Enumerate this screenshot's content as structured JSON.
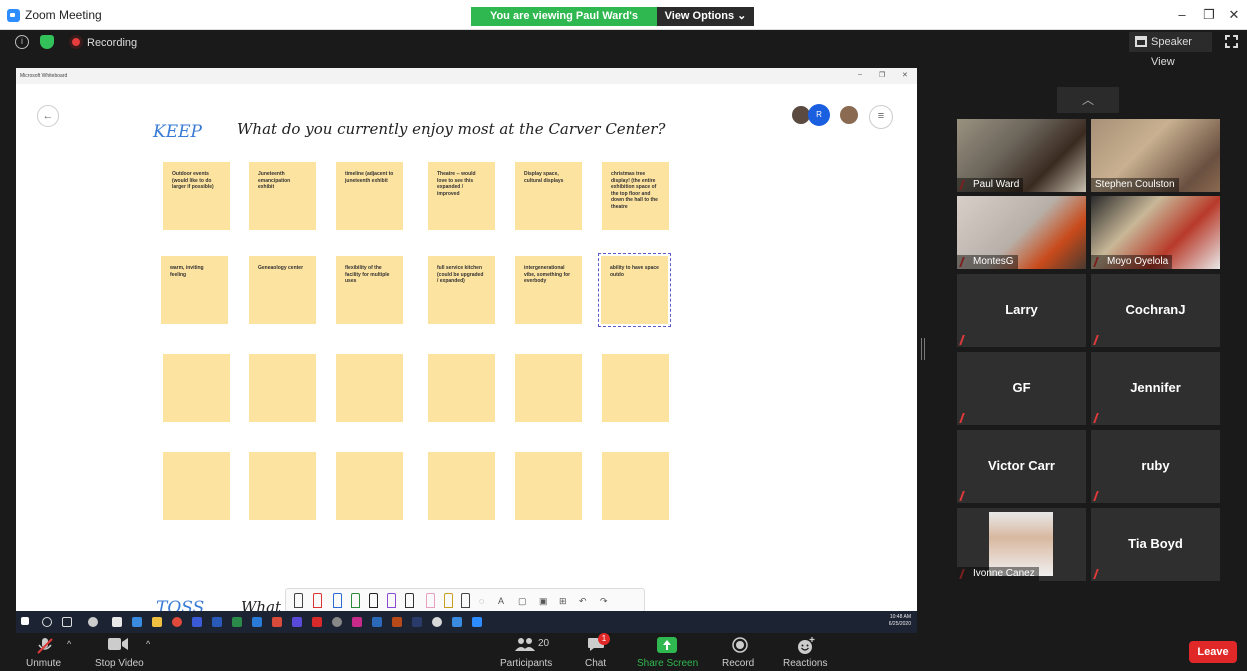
{
  "window": {
    "title": "Zoom Meeting"
  },
  "banner": {
    "text": "You are viewing Paul Ward's screen",
    "view_options": "View Options ⌄"
  },
  "status": {
    "recording": "Recording"
  },
  "top_right": {
    "speaker_view": "Speaker View"
  },
  "whiteboard": {
    "window_title": "Microsoft Whiteboard",
    "keep": "KEEP",
    "question": "What do you currently enjoy most at the Carver Center?",
    "toss": "TOSS",
    "toss_question": "What",
    "avatar_initial": "R",
    "notes_row1": [
      "Outdoor events (would like to do larger if possible)",
      "Juneteenth emancipation exhibit",
      "timeline (adjacent to juneteenth exhibit",
      "Theatre -- would love to see this expanded / improved",
      "Display space, cultural displays",
      "christmas tree display! (the entire exhibition space of the top floor and down the hall to the theatre"
    ],
    "notes_row2": [
      "warm, inviting feeling",
      "Geneaology center",
      "flexibility of the facility for multiple uses",
      "full service kitchen (could be upgraded / expanded)",
      "intergenerational vibe, something for everbody",
      "ability to have space outdo"
    ],
    "taskbar_time": "10:48 AM",
    "taskbar_date": "6/25/2020"
  },
  "participants_tiles": [
    {
      "name": "Paul Ward",
      "video": true
    },
    {
      "name": "Stephen Coulston",
      "video": true
    },
    {
      "name": "MontesG",
      "video": true
    },
    {
      "name": "Moyo Oyelola",
      "video": true
    },
    {
      "name": "Larry",
      "video": false
    },
    {
      "name": "CochranJ",
      "video": false
    },
    {
      "name": "GF",
      "video": false
    },
    {
      "name": "Jennifer",
      "video": false
    },
    {
      "name": "Victor Carr",
      "video": false
    },
    {
      "name": "ruby",
      "video": false
    },
    {
      "name": "Ivonne Canez",
      "video": true
    },
    {
      "name": "Tia Boyd",
      "video": false
    }
  ],
  "controls": {
    "unmute": "Unmute",
    "stop_video": "Stop Video",
    "participants": "Participants",
    "participants_count": "20",
    "chat": "Chat",
    "chat_badge": "1",
    "share_screen": "Share Screen",
    "record": "Record",
    "reactions": "Reactions",
    "leave": "Leave"
  },
  "colors": {
    "accent_green": "#2fb84f",
    "leave_red": "#e02828",
    "sticky_yellow": "#fde3a0",
    "keep_blue": "#3a7bd5"
  }
}
